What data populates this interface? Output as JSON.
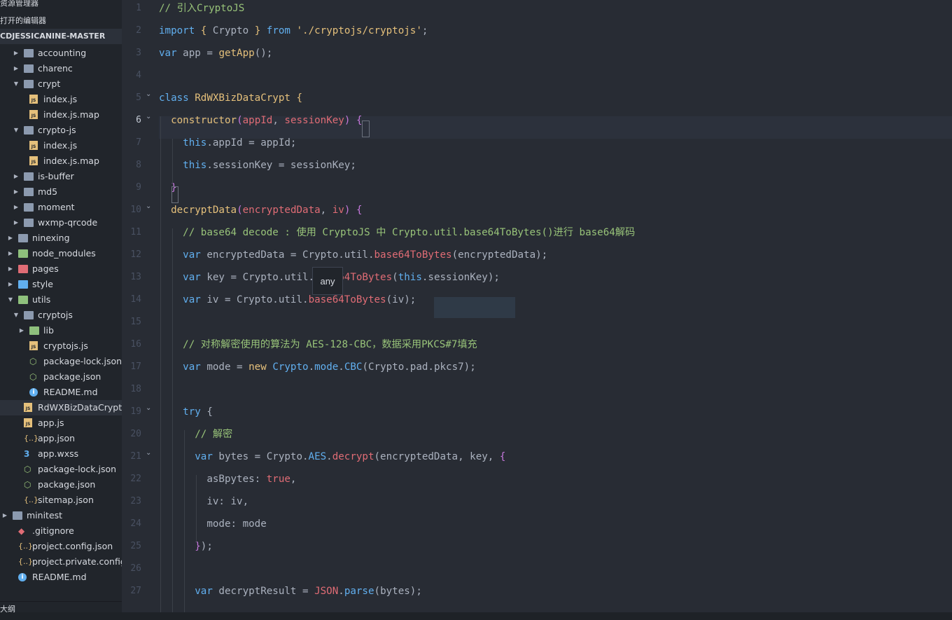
{
  "sidebar": {
    "title": "资源管理器",
    "more": "···",
    "open_editors": "打开的编辑器",
    "root": "CDJESSICANINE-MASTER",
    "items": [
      {
        "label": "accounting",
        "depth": 1,
        "type": "folder",
        "state": "closed"
      },
      {
        "label": "charenc",
        "depth": 1,
        "type": "folder",
        "state": "closed"
      },
      {
        "label": "crypt",
        "depth": 1,
        "type": "folder",
        "state": "open"
      },
      {
        "label": "index.js",
        "depth": 2,
        "type": "js"
      },
      {
        "label": "index.js.map",
        "depth": 2,
        "type": "js"
      },
      {
        "label": "crypto-js",
        "depth": 1,
        "type": "folder",
        "state": "open"
      },
      {
        "label": "index.js",
        "depth": 2,
        "type": "js"
      },
      {
        "label": "index.js.map",
        "depth": 2,
        "type": "js"
      },
      {
        "label": "is-buffer",
        "depth": 1,
        "type": "folder",
        "state": "closed"
      },
      {
        "label": "md5",
        "depth": 1,
        "type": "folder",
        "state": "closed"
      },
      {
        "label": "moment",
        "depth": 1,
        "type": "folder",
        "state": "closed"
      },
      {
        "label": "wxmp-qrcode",
        "depth": 1,
        "type": "folder",
        "state": "closed"
      },
      {
        "label": "ninexing",
        "depth": 0,
        "type": "folder",
        "state": "closed"
      },
      {
        "label": "node_modules",
        "depth": 0,
        "type": "folder-green",
        "state": "closed"
      },
      {
        "label": "pages",
        "depth": 0,
        "type": "folder-red",
        "state": "closed"
      },
      {
        "label": "style",
        "depth": 0,
        "type": "folder-blue",
        "state": "closed"
      },
      {
        "label": "utils",
        "depth": 0,
        "type": "folder-green",
        "state": "open"
      },
      {
        "label": "cryptojs",
        "depth": 1,
        "type": "folder",
        "state": "open"
      },
      {
        "label": "lib",
        "depth": 2,
        "type": "folder-green",
        "state": "closed"
      },
      {
        "label": "cryptojs.js",
        "depth": 2,
        "type": "js"
      },
      {
        "label": "package-lock.json",
        "depth": 2,
        "type": "node"
      },
      {
        "label": "package.json",
        "depth": 2,
        "type": "node"
      },
      {
        "label": "README.md",
        "depth": 2,
        "type": "info"
      },
      {
        "label": "RdWXBizDataCrypt.js",
        "depth": 1,
        "type": "js",
        "selected": true
      },
      {
        "label": "app.js",
        "depth": 0,
        "type": "js",
        "indent": 1
      },
      {
        "label": "app.json",
        "depth": 0,
        "type": "json",
        "indent": 1
      },
      {
        "label": "app.wxss",
        "depth": 0,
        "type": "css",
        "indent": 1
      },
      {
        "label": "package-lock.json",
        "depth": 0,
        "type": "node",
        "indent": 1
      },
      {
        "label": "package.json",
        "depth": 0,
        "type": "node",
        "indent": 1
      },
      {
        "label": "sitemap.json",
        "depth": 0,
        "type": "json",
        "indent": 1
      },
      {
        "label": "minitest",
        "depth": -1,
        "type": "folder",
        "state": "closed"
      },
      {
        "label": ".gitignore",
        "depth": -1,
        "type": "git",
        "indent": 1
      },
      {
        "label": "project.config.json",
        "depth": -1,
        "type": "json",
        "indent": 1
      },
      {
        "label": "project.private.config.js...",
        "depth": -1,
        "type": "json",
        "indent": 1
      },
      {
        "label": "README.md",
        "depth": -1,
        "type": "info",
        "indent": 1
      }
    ],
    "outline": "大纲"
  },
  "editor": {
    "active_line": 6,
    "tooltip": "any",
    "lines": [
      {
        "n": 1,
        "fold": false,
        "tokens": [
          [
            "cm",
            "// 引入CryptoJS"
          ]
        ]
      },
      {
        "n": 2,
        "fold": false,
        "tokens": [
          [
            "kw",
            "import "
          ],
          [
            "fn",
            "{ "
          ],
          [
            "pun",
            "Crypto "
          ],
          [
            "fn",
            "} "
          ],
          [
            "kw",
            "from "
          ],
          [
            "str",
            "'./cryptojs/cryptojs'"
          ],
          [
            "pun",
            ";"
          ]
        ]
      },
      {
        "n": 3,
        "fold": false,
        "tokens": [
          [
            "kw",
            "var "
          ],
          [
            "pun",
            "app "
          ],
          [
            "pun",
            "= "
          ],
          [
            "fn",
            "getApp"
          ],
          [
            "pun",
            "();"
          ]
        ]
      },
      {
        "n": 4,
        "fold": false,
        "tokens": []
      },
      {
        "n": 5,
        "fold": true,
        "tokens": [
          [
            "kw",
            "class "
          ],
          [
            "fn",
            "RdWXBizDataCrypt "
          ],
          [
            "fn",
            "{"
          ]
        ]
      },
      {
        "n": 6,
        "fold": true,
        "tokens": [
          [
            "pun",
            "  "
          ],
          [
            "fn",
            "constructor"
          ],
          [
            "key",
            "("
          ],
          [
            "prop",
            "appId"
          ],
          [
            "pun",
            ", "
          ],
          [
            "prop",
            "sessionKey"
          ],
          [
            "key",
            ") "
          ],
          [
            "key",
            "{"
          ]
        ]
      },
      {
        "n": 7,
        "fold": false,
        "tokens": [
          [
            "pun",
            "    "
          ],
          [
            "kw",
            "this"
          ],
          [
            "pun",
            ".appId = appId;"
          ]
        ]
      },
      {
        "n": 8,
        "fold": false,
        "tokens": [
          [
            "pun",
            "    "
          ],
          [
            "kw",
            "this"
          ],
          [
            "pun",
            ".sessionKey = sessionKey;"
          ]
        ]
      },
      {
        "n": 9,
        "fold": false,
        "tokens": [
          [
            "pun",
            "  "
          ],
          [
            "key",
            "}"
          ]
        ]
      },
      {
        "n": 10,
        "fold": true,
        "tokens": [
          [
            "pun",
            "  "
          ],
          [
            "fn",
            "decryptData"
          ],
          [
            "key",
            "("
          ],
          [
            "prop",
            "encryptedData"
          ],
          [
            "pun",
            ", "
          ],
          [
            "prop",
            "iv"
          ],
          [
            "key",
            ") "
          ],
          [
            "key",
            "{"
          ]
        ]
      },
      {
        "n": 11,
        "fold": false,
        "tokens": [
          [
            "pun",
            "    "
          ],
          [
            "cm",
            "// base64 decode : 使用 CryptoJS 中 Crypto.util.base64ToBytes()进行 base64解码"
          ]
        ]
      },
      {
        "n": 12,
        "fold": false,
        "tokens": [
          [
            "pun",
            "    "
          ],
          [
            "kw",
            "var "
          ],
          [
            "pun",
            "encryptedData = Crypto.util."
          ],
          [
            "prop",
            "base64ToBytes"
          ],
          [
            "pun",
            "(encryptedData);"
          ]
        ]
      },
      {
        "n": 13,
        "fold": false,
        "tokens": [
          [
            "pun",
            "    "
          ],
          [
            "kw",
            "var "
          ],
          [
            "pun",
            "key = Crypto.util.ba"
          ],
          [
            "prop",
            "se64ToBytes"
          ],
          [
            "pun",
            "("
          ],
          [
            "kw",
            "this"
          ],
          [
            "pun",
            ".sessionKey);"
          ]
        ]
      },
      {
        "n": 14,
        "fold": false,
        "tokens": [
          [
            "pun",
            "    "
          ],
          [
            "kw",
            "var "
          ],
          [
            "pun",
            "iv = Crypto.util."
          ],
          [
            "prop",
            "base64ToBytes"
          ],
          [
            "pun",
            "(iv);"
          ]
        ]
      },
      {
        "n": 15,
        "fold": false,
        "tokens": []
      },
      {
        "n": 16,
        "fold": false,
        "tokens": [
          [
            "pun",
            "    "
          ],
          [
            "cm",
            "// 对称解密使用的算法为 AES-128-CBC，数据采用PKCS#7填充"
          ]
        ]
      },
      {
        "n": 17,
        "fold": false,
        "tokens": [
          [
            "pun",
            "    "
          ],
          [
            "kw",
            "var "
          ],
          [
            "pun",
            "mode = "
          ],
          [
            "fn",
            "new "
          ],
          [
            "kw",
            "Crypto"
          ],
          [
            "pun",
            "."
          ],
          [
            "kw",
            "mode"
          ],
          [
            "pun",
            "."
          ],
          [
            "kw",
            "CBC"
          ],
          [
            "pun",
            "(Crypto.pad.pkcs7);"
          ]
        ]
      },
      {
        "n": 18,
        "fold": false,
        "tokens": []
      },
      {
        "n": 19,
        "fold": true,
        "tokens": [
          [
            "pun",
            "    "
          ],
          [
            "kw",
            "try "
          ],
          [
            "pun",
            "{"
          ]
        ]
      },
      {
        "n": 20,
        "fold": false,
        "tokens": [
          [
            "pun",
            "      "
          ],
          [
            "cm",
            "// 解密"
          ]
        ]
      },
      {
        "n": 21,
        "fold": true,
        "tokens": [
          [
            "pun",
            "      "
          ],
          [
            "kw",
            "var "
          ],
          [
            "pun",
            "bytes = Crypto."
          ],
          [
            "kw",
            "AES"
          ],
          [
            "pun",
            "."
          ],
          [
            "prop",
            "decrypt"
          ],
          [
            "pun",
            "(encryptedData, key, "
          ],
          [
            "key",
            "{"
          ]
        ]
      },
      {
        "n": 22,
        "fold": false,
        "tokens": [
          [
            "pun",
            "        asBpytes: "
          ],
          [
            "prop",
            "true"
          ],
          [
            "pun",
            ","
          ]
        ]
      },
      {
        "n": 23,
        "fold": false,
        "tokens": [
          [
            "pun",
            "        iv: iv,"
          ]
        ]
      },
      {
        "n": 24,
        "fold": false,
        "tokens": [
          [
            "pun",
            "        mode: mode"
          ]
        ]
      },
      {
        "n": 25,
        "fold": false,
        "tokens": [
          [
            "pun",
            "      "
          ],
          [
            "key",
            "}"
          ],
          [
            "pun",
            ");"
          ]
        ]
      },
      {
        "n": 26,
        "fold": false,
        "tokens": []
      },
      {
        "n": 27,
        "fold": false,
        "tokens": [
          [
            "pun",
            "      "
          ],
          [
            "kw",
            "var "
          ],
          [
            "pun",
            "decryptResult = "
          ],
          [
            "prop",
            "JSON"
          ],
          [
            "pun",
            "."
          ],
          [
            "kw",
            "parse"
          ],
          [
            "pun",
            "(bytes);"
          ]
        ]
      }
    ]
  }
}
